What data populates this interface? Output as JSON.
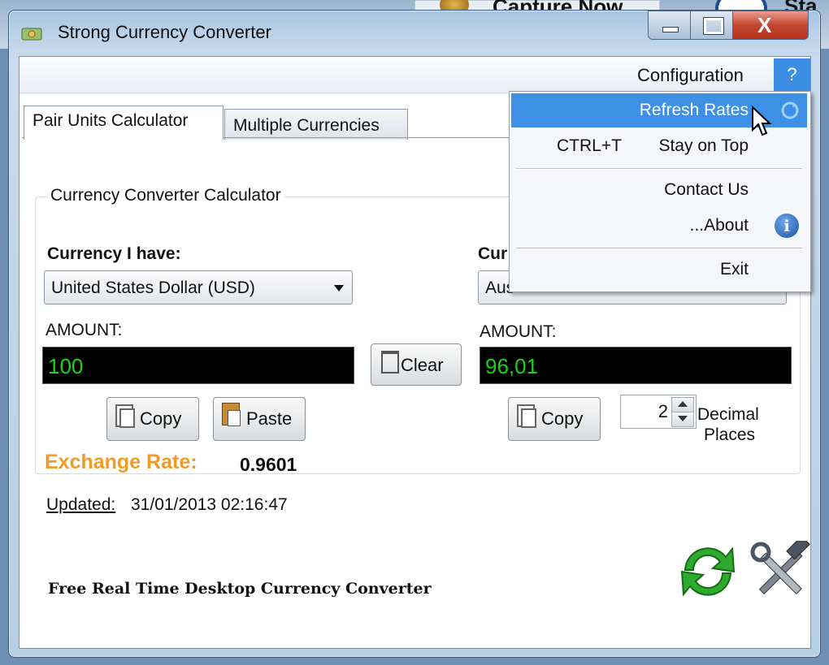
{
  "background": {
    "capture_label": "Capture Now",
    "sta_label": "Sta"
  },
  "window": {
    "title": "Strong Currency Converter",
    "close_glyph": "X"
  },
  "menubar": {
    "configuration": "Configuration",
    "help": "?"
  },
  "tabs": [
    {
      "label": "Pair Units Calculator",
      "active": true
    },
    {
      "label": "Multiple Currencies",
      "active": false
    }
  ],
  "calculator": {
    "group_title": "Currency Converter Calculator",
    "have_label": "Currency I have:",
    "have_value": "United States Dollar (USD)",
    "want_label_visible": "Cur",
    "want_value_visible": "Aus",
    "amount_label_left": "AMOUNT:",
    "amount_left": "100",
    "amount_label_right": "AMOUNT:",
    "amount_right": "96,01",
    "clear_label": "Clear",
    "copy_left_label": "Copy",
    "paste_label": "Paste",
    "copy_right_label": "Copy",
    "decimal_value": "2",
    "decimal_label_1": "Decimal",
    "decimal_label_2": "Places"
  },
  "rate": {
    "label": "Exchange Rate:",
    "value": "0.9601",
    "updated_label": "Updated:",
    "updated_value": "31/01/2013 02:16:47"
  },
  "footer": "Free Real Time Desktop Currency Converter",
  "dropdown": {
    "refresh": "Refresh Rates",
    "stay_shortcut": "CTRL+T",
    "stay": "Stay on Top",
    "contact": "Contact Us",
    "about": "...About",
    "info_glyph": "i",
    "exit": "Exit"
  },
  "colors": {
    "accent_orange": "#f19a25",
    "menu_highlight": "#3d90e6",
    "amount_text": "#1bd21b"
  }
}
